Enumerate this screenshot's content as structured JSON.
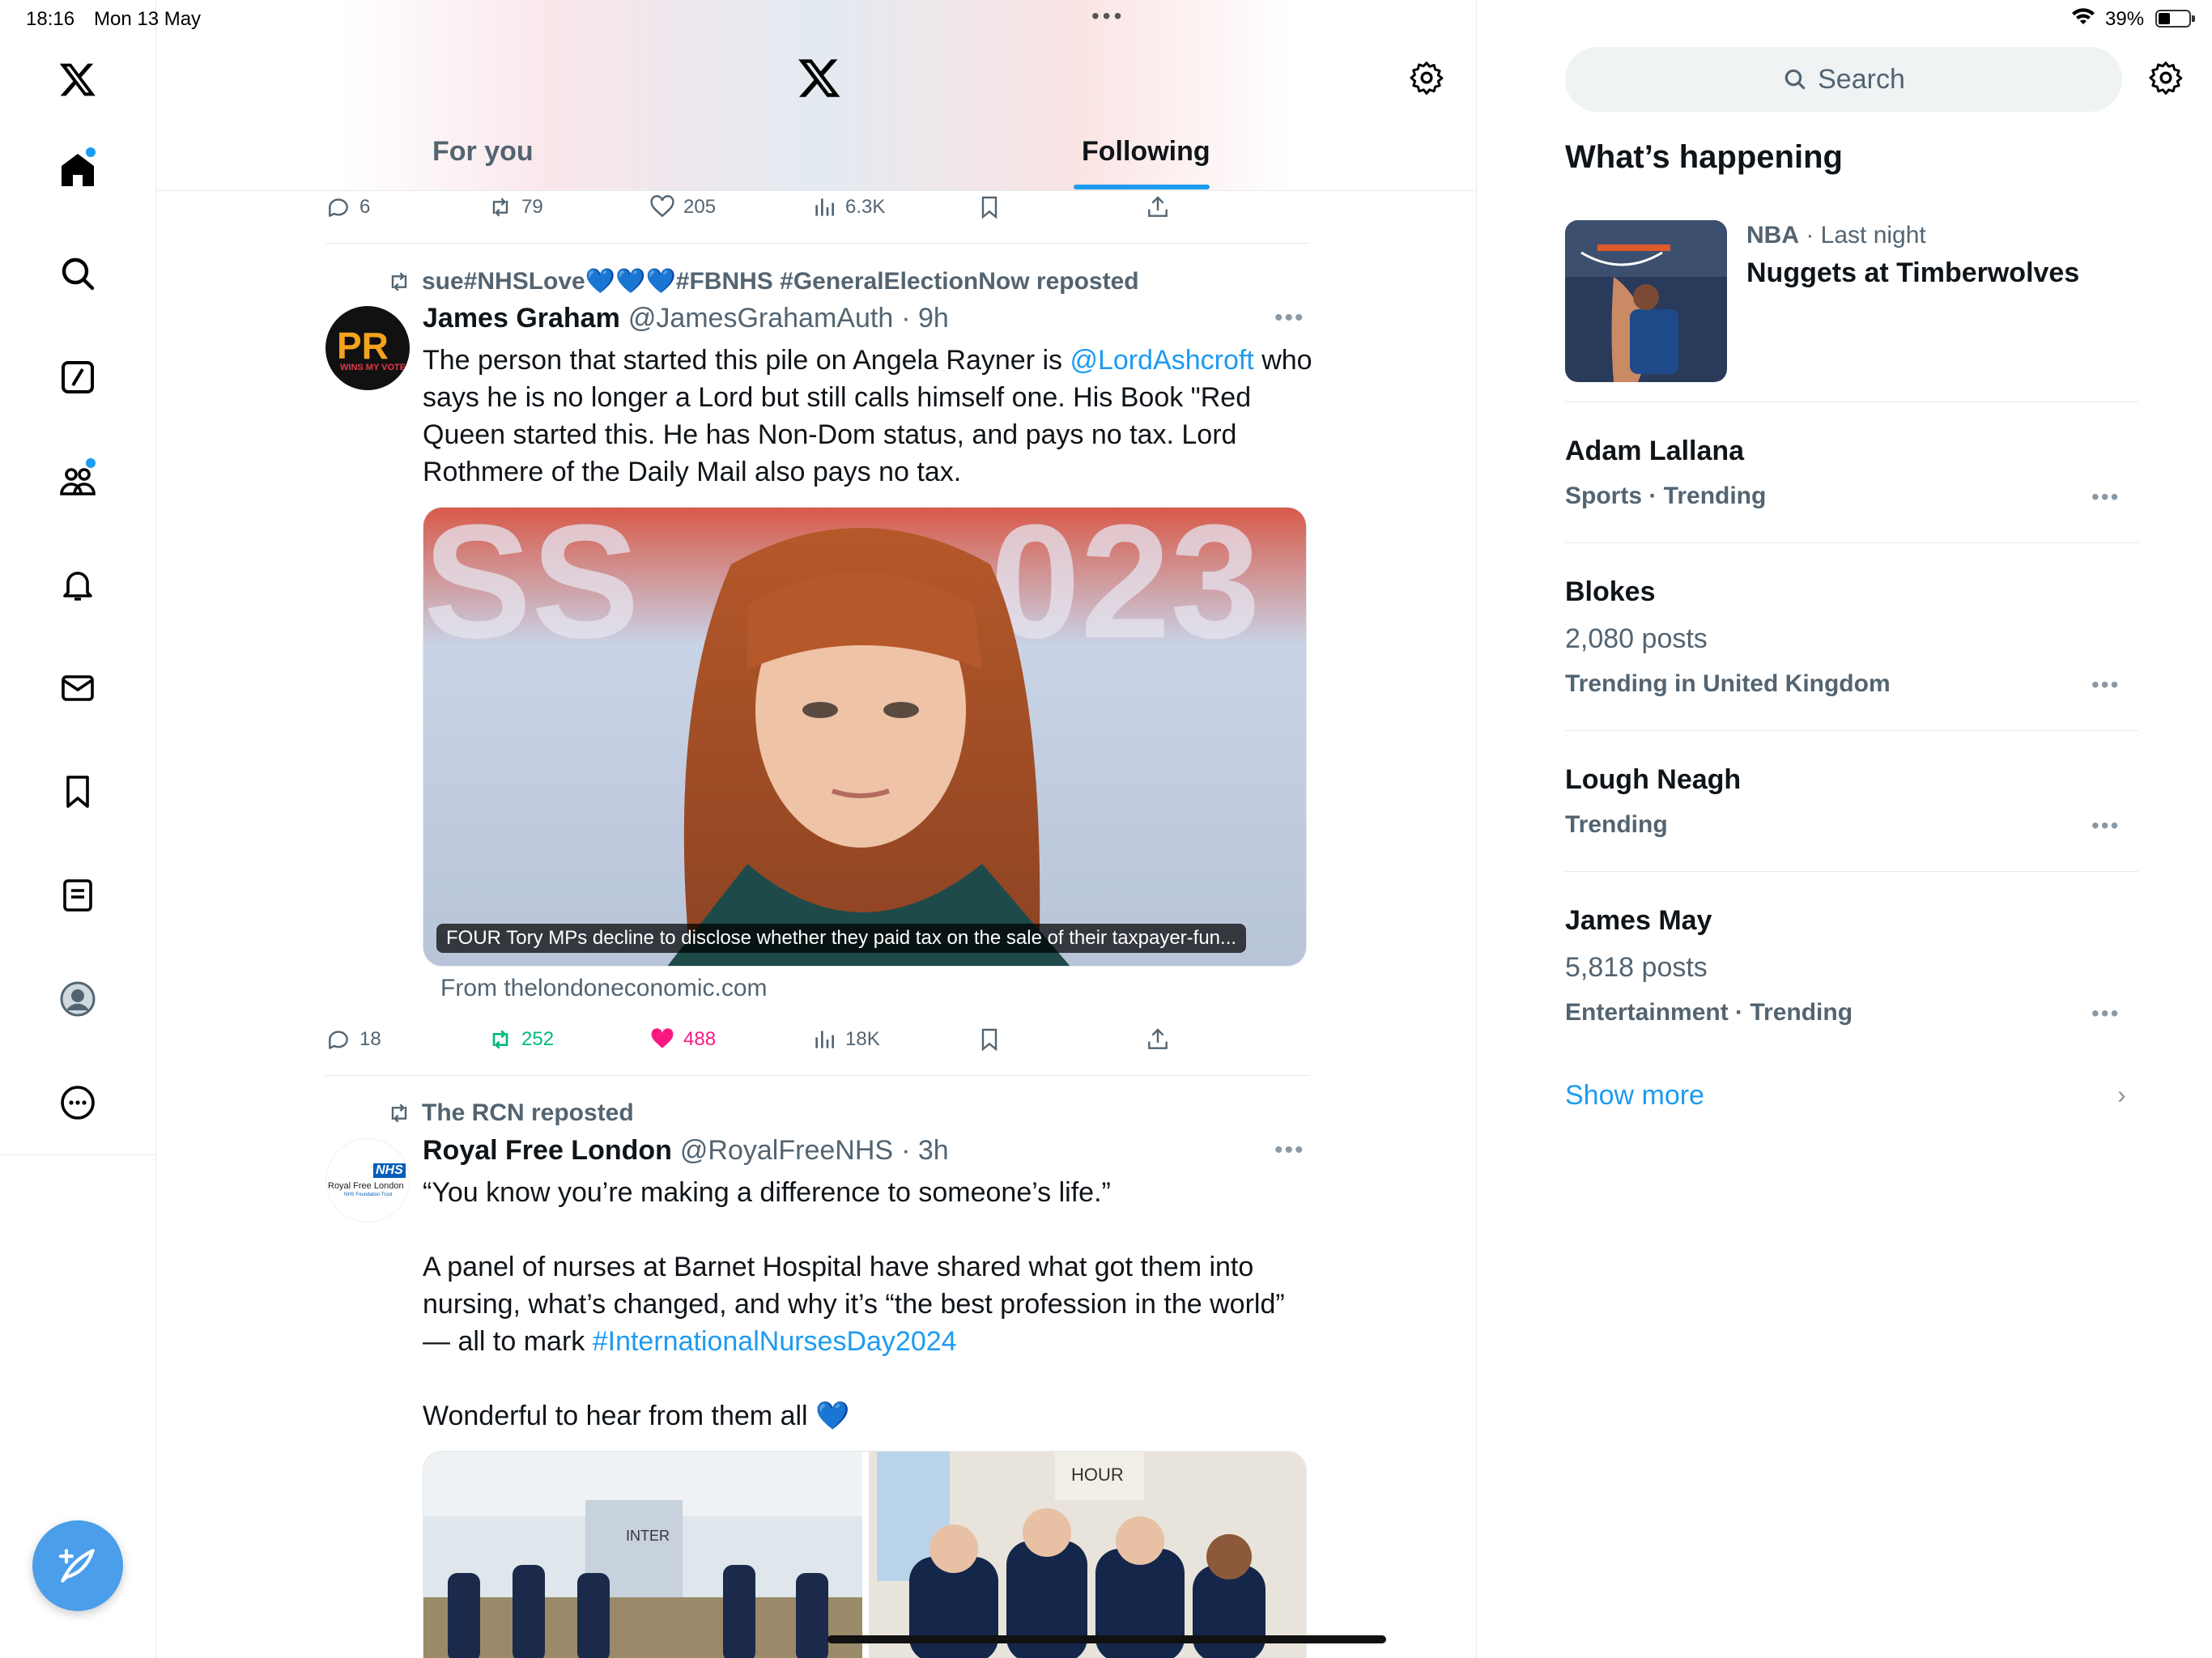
{
  "status_bar": {
    "time": "18:16",
    "date": "Mon 13 May",
    "battery": "39%"
  },
  "header": {
    "tabs": [
      {
        "label": "For you"
      },
      {
        "label": "Following"
      }
    ],
    "active_tab": "Following"
  },
  "prev_tweet_actions": {
    "replies": "6",
    "reposts": "79",
    "likes": "205",
    "views": "6.3K"
  },
  "tweets": [
    {
      "reposted_by": "sue#NHSLove💙💙💙#FBNHS #GeneralElectionNow reposted",
      "name": "James Graham",
      "handle": "@JamesGrahamAuth",
      "time": "· 9h",
      "text_before": "The person that started this pile on Angela Rayner is ",
      "mention": "@LordAshcroft",
      "text_after": " who says he is no longer a Lord but still calls himself one. His Book \"Red Queen started this. He has Non-Dom status, and pays no tax. Lord Rothmere of the Daily Mail also pays no tax.",
      "media_caption": "FOUR Tory MPs decline to disclose whether they paid tax on the sale of their taxpayer-fun...",
      "from": "From thelondoneconomic.com",
      "replies": "18",
      "reposts": "252",
      "likes": "488",
      "views": "18K",
      "avatar_text": "PR",
      "avatar_subtext": "WINS MY VOTE!"
    },
    {
      "reposted_by": "The RCN reposted",
      "name": "Royal Free London",
      "handle": "@RoyalFreeNHS",
      "time": "· 3h",
      "line1": "“You know you’re making a difference to someone’s life.”",
      "line2": "A panel of nurses at Barnet Hospital have shared what got them into nursing, what’s changed, and why it’s “the best profession in the world” — all to mark ",
      "hashtag": "#InternationalNursesDay2024",
      "line3": "Wonderful to hear from them all 💙",
      "avatar_logo": "NHS",
      "avatar_name": "Royal Free London",
      "avatar_sub": "NHS Foundation Trust"
    }
  ],
  "sidebar": {
    "search_placeholder": "Search",
    "title": "What’s happening",
    "trends": [
      {
        "meta_bold": "NBA",
        "meta": " · Last night",
        "title": "Nuggets at Timberwolves"
      },
      {
        "title": "Adam Lallana",
        "sub": "Sports · Trending"
      },
      {
        "title": "Blokes",
        "count": "2,080 posts",
        "sub": "Trending in United Kingdom"
      },
      {
        "title": "Lough Neagh",
        "sub": "Trending"
      },
      {
        "title": "James May",
        "count": "5,818 posts",
        "sub": "Entertainment · Trending"
      }
    ],
    "show_more": "Show more"
  },
  "colors": {
    "accent": "#1d9bf0",
    "repost_green": "#00ba7c",
    "like_pink": "#f91880",
    "muted": "#536471"
  }
}
